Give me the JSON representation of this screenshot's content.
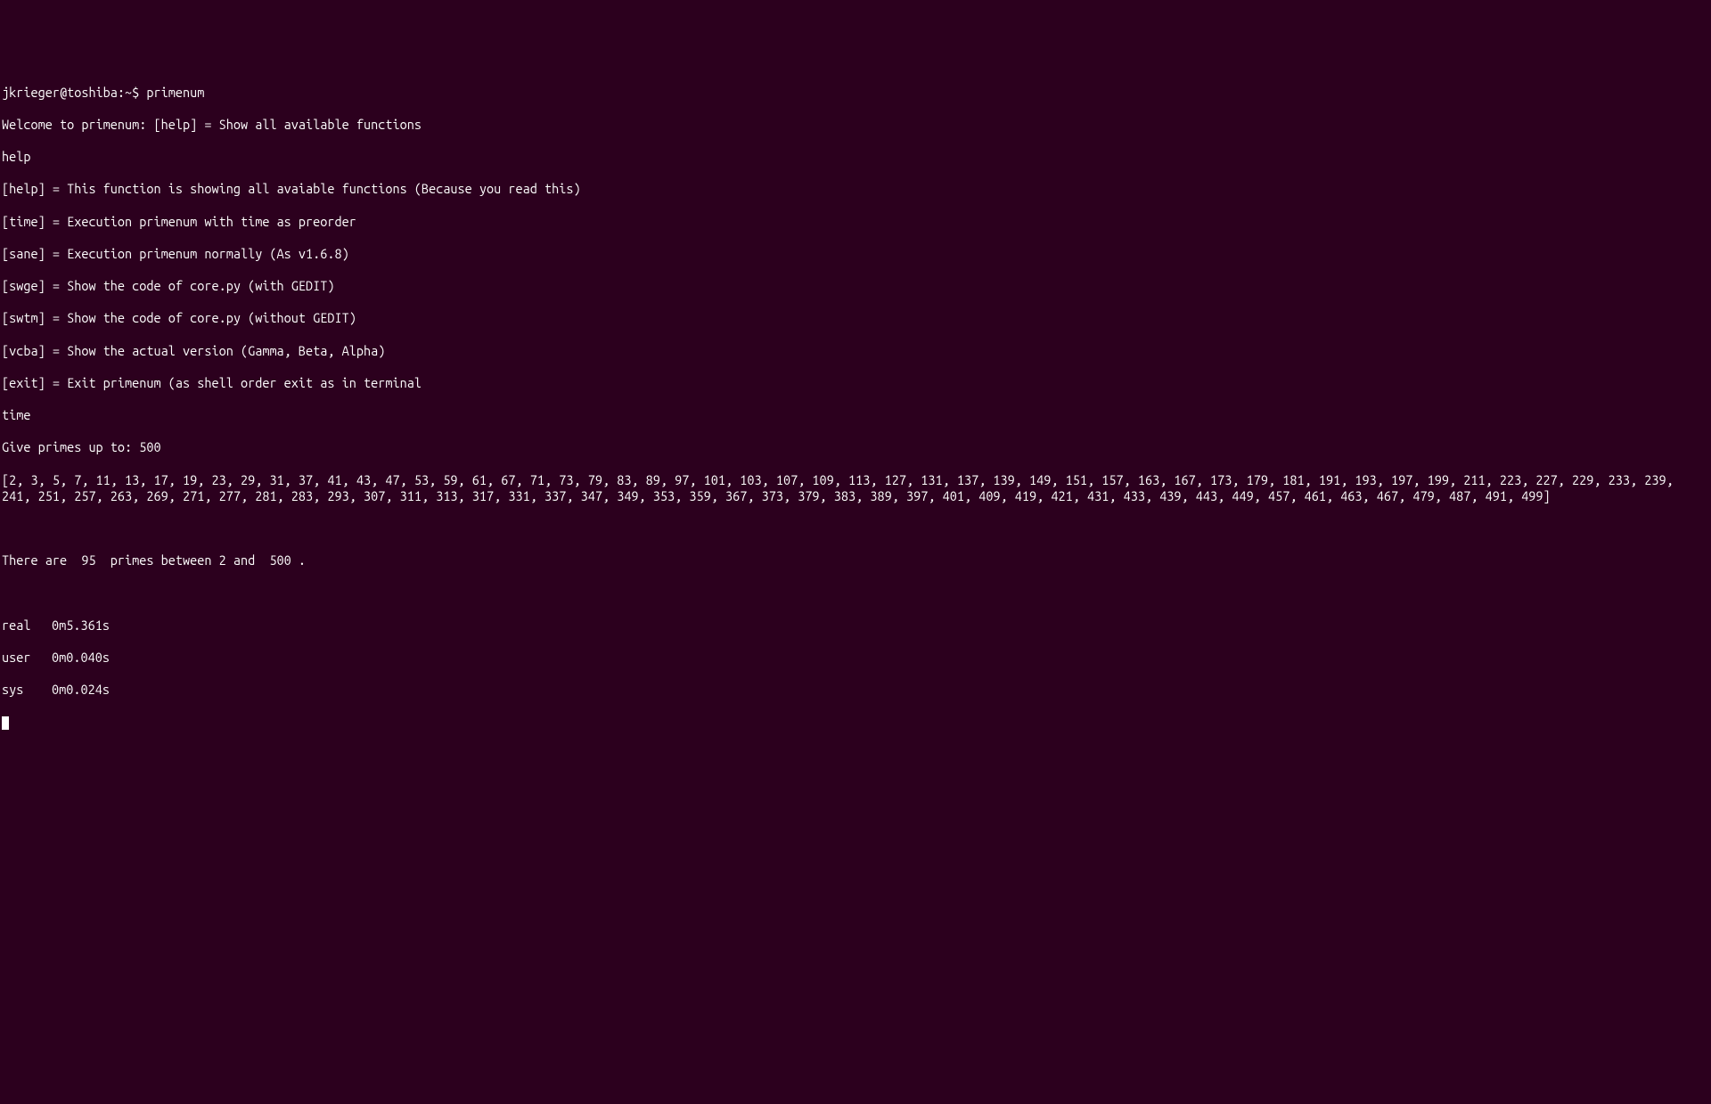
{
  "prompt": {
    "user_host": "jkrieger@toshiba",
    "path": ":~$",
    "command": "primenum"
  },
  "welcome": "Welcome to primenum: [help] = Show all available functions",
  "input_help": "help",
  "help_entries": {
    "help": "[help] = This function is showing all avaiable functions (Because you read this)",
    "time": "[time] = Execution primenum with time as preorder",
    "sane": "[sane] = Execution primenum normally (As v1.6.8)",
    "swge": "[swge] = Show the code of core.py (with GEDIT)",
    "swtm": "[swtm] = Show the code of core.py (without GEDIT)",
    "vcba": "[vcba] = Show the actual version (Gamma, Beta, Alpha)",
    "exit": "[exit] = Exit primenum (as shell order exit as in terminal"
  },
  "input_time": "time",
  "primes_prompt": "Give primes up to: 500",
  "primes_output": "[2, 3, 5, 7, 11, 13, 17, 19, 23, 29, 31, 37, 41, 43, 47, 53, 59, 61, 67, 71, 73, 79, 83, 89, 97, 101, 103, 107, 109, 113, 127, 131, 137, 139, 149, 151, 157, 163, 167, 173, 179, 181, 191, 193, 197, 199, 211, 223, 227, 229, 233, 239, 241, 251, 257, 263, 269, 271, 277, 281, 283, 293, 307, 311, 313, 317, 331, 337, 347, 349, 353, 359, 367, 373, 379, 383, 389, 397, 401, 409, 419, 421, 431, 433, 439, 443, 449, 457, 461, 463, 467, 479, 487, 491, 499]",
  "summary": "There are  95  primes between 2 and  500 .",
  "timing": {
    "real_label": "real",
    "real_value": "0m5.361s",
    "user_label": "user",
    "user_value": "0m0.040s",
    "sys_label": "sys",
    "sys_value": "0m0.024s"
  }
}
